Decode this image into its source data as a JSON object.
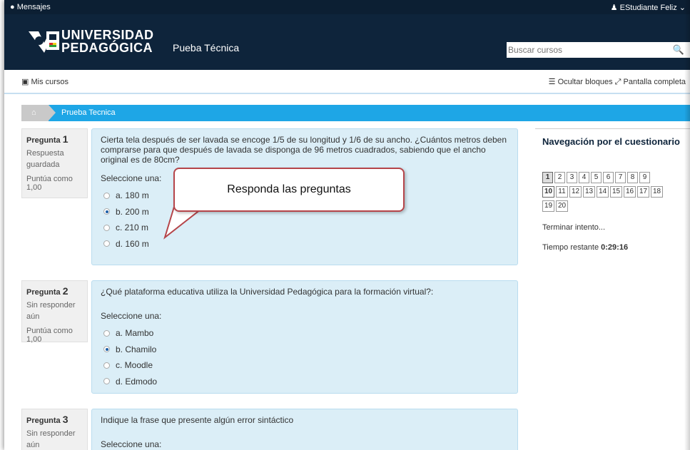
{
  "topbar": {
    "messages": "Mensajes",
    "user": "EStudiante Feliz"
  },
  "header": {
    "university_line1": "UNIVERSIDAD",
    "university_line2": "PEDAGÓGICA",
    "course": "Pueba Técnica",
    "search_placeholder": "Buscar cursos"
  },
  "navbar": {
    "my_courses": "Mis cursos",
    "hide_blocks": "Ocultar bloques",
    "fullscreen": "Pantalla completa"
  },
  "breadcrumb": {
    "item": "Prueba Tecnica"
  },
  "callout": "Responda las preguntas",
  "questions": [
    {
      "label": "Pregunta",
      "number": "1",
      "status": "Respuesta guardada",
      "points": "Puntúa como 1,00",
      "text": "Cierta tela después de ser lavada se encoge 1/5 de su longitud y 1/6 de su ancho. ¿Cuántos metros deben comprarse para que después de lavada se disponga de 96 metros cuadrados, sabiendo que el ancho original es de 80cm?",
      "select": "Seleccione una:",
      "options": [
        "a. 180 m",
        "b. 200 m",
        "c. 210 m",
        "d. 160 m"
      ],
      "selected": 1
    },
    {
      "label": "Pregunta",
      "number": "2",
      "status": "Sin responder aún",
      "points": "Puntúa como 1,00",
      "text": "¿Qué plataforma educativa utiliza la Universidad Pedagógica para la formación virtual?:",
      "select": "Seleccione una:",
      "options": [
        "a. Mambo",
        "b. Chamilo",
        "c. Moodle",
        "d. Edmodo"
      ],
      "selected": 1
    },
    {
      "label": "Pregunta",
      "number": "3",
      "status": "Sin responder aún",
      "points": "",
      "text": "Indique la frase que presente algún error sintáctico",
      "select": "Seleccione una:",
      "options": [],
      "selected": -1
    }
  ],
  "sidebar": {
    "title": "Navegación por el cuestionario",
    "numbers": [
      "1",
      "2",
      "3",
      "4",
      "5",
      "6",
      "7",
      "8",
      "9",
      "10",
      "11",
      "12",
      "13",
      "14",
      "15",
      "16",
      "17",
      "18",
      "19",
      "20"
    ],
    "finish": "Terminar intento...",
    "time_label": "Tiempo restante",
    "time_value": "0:29:16"
  }
}
